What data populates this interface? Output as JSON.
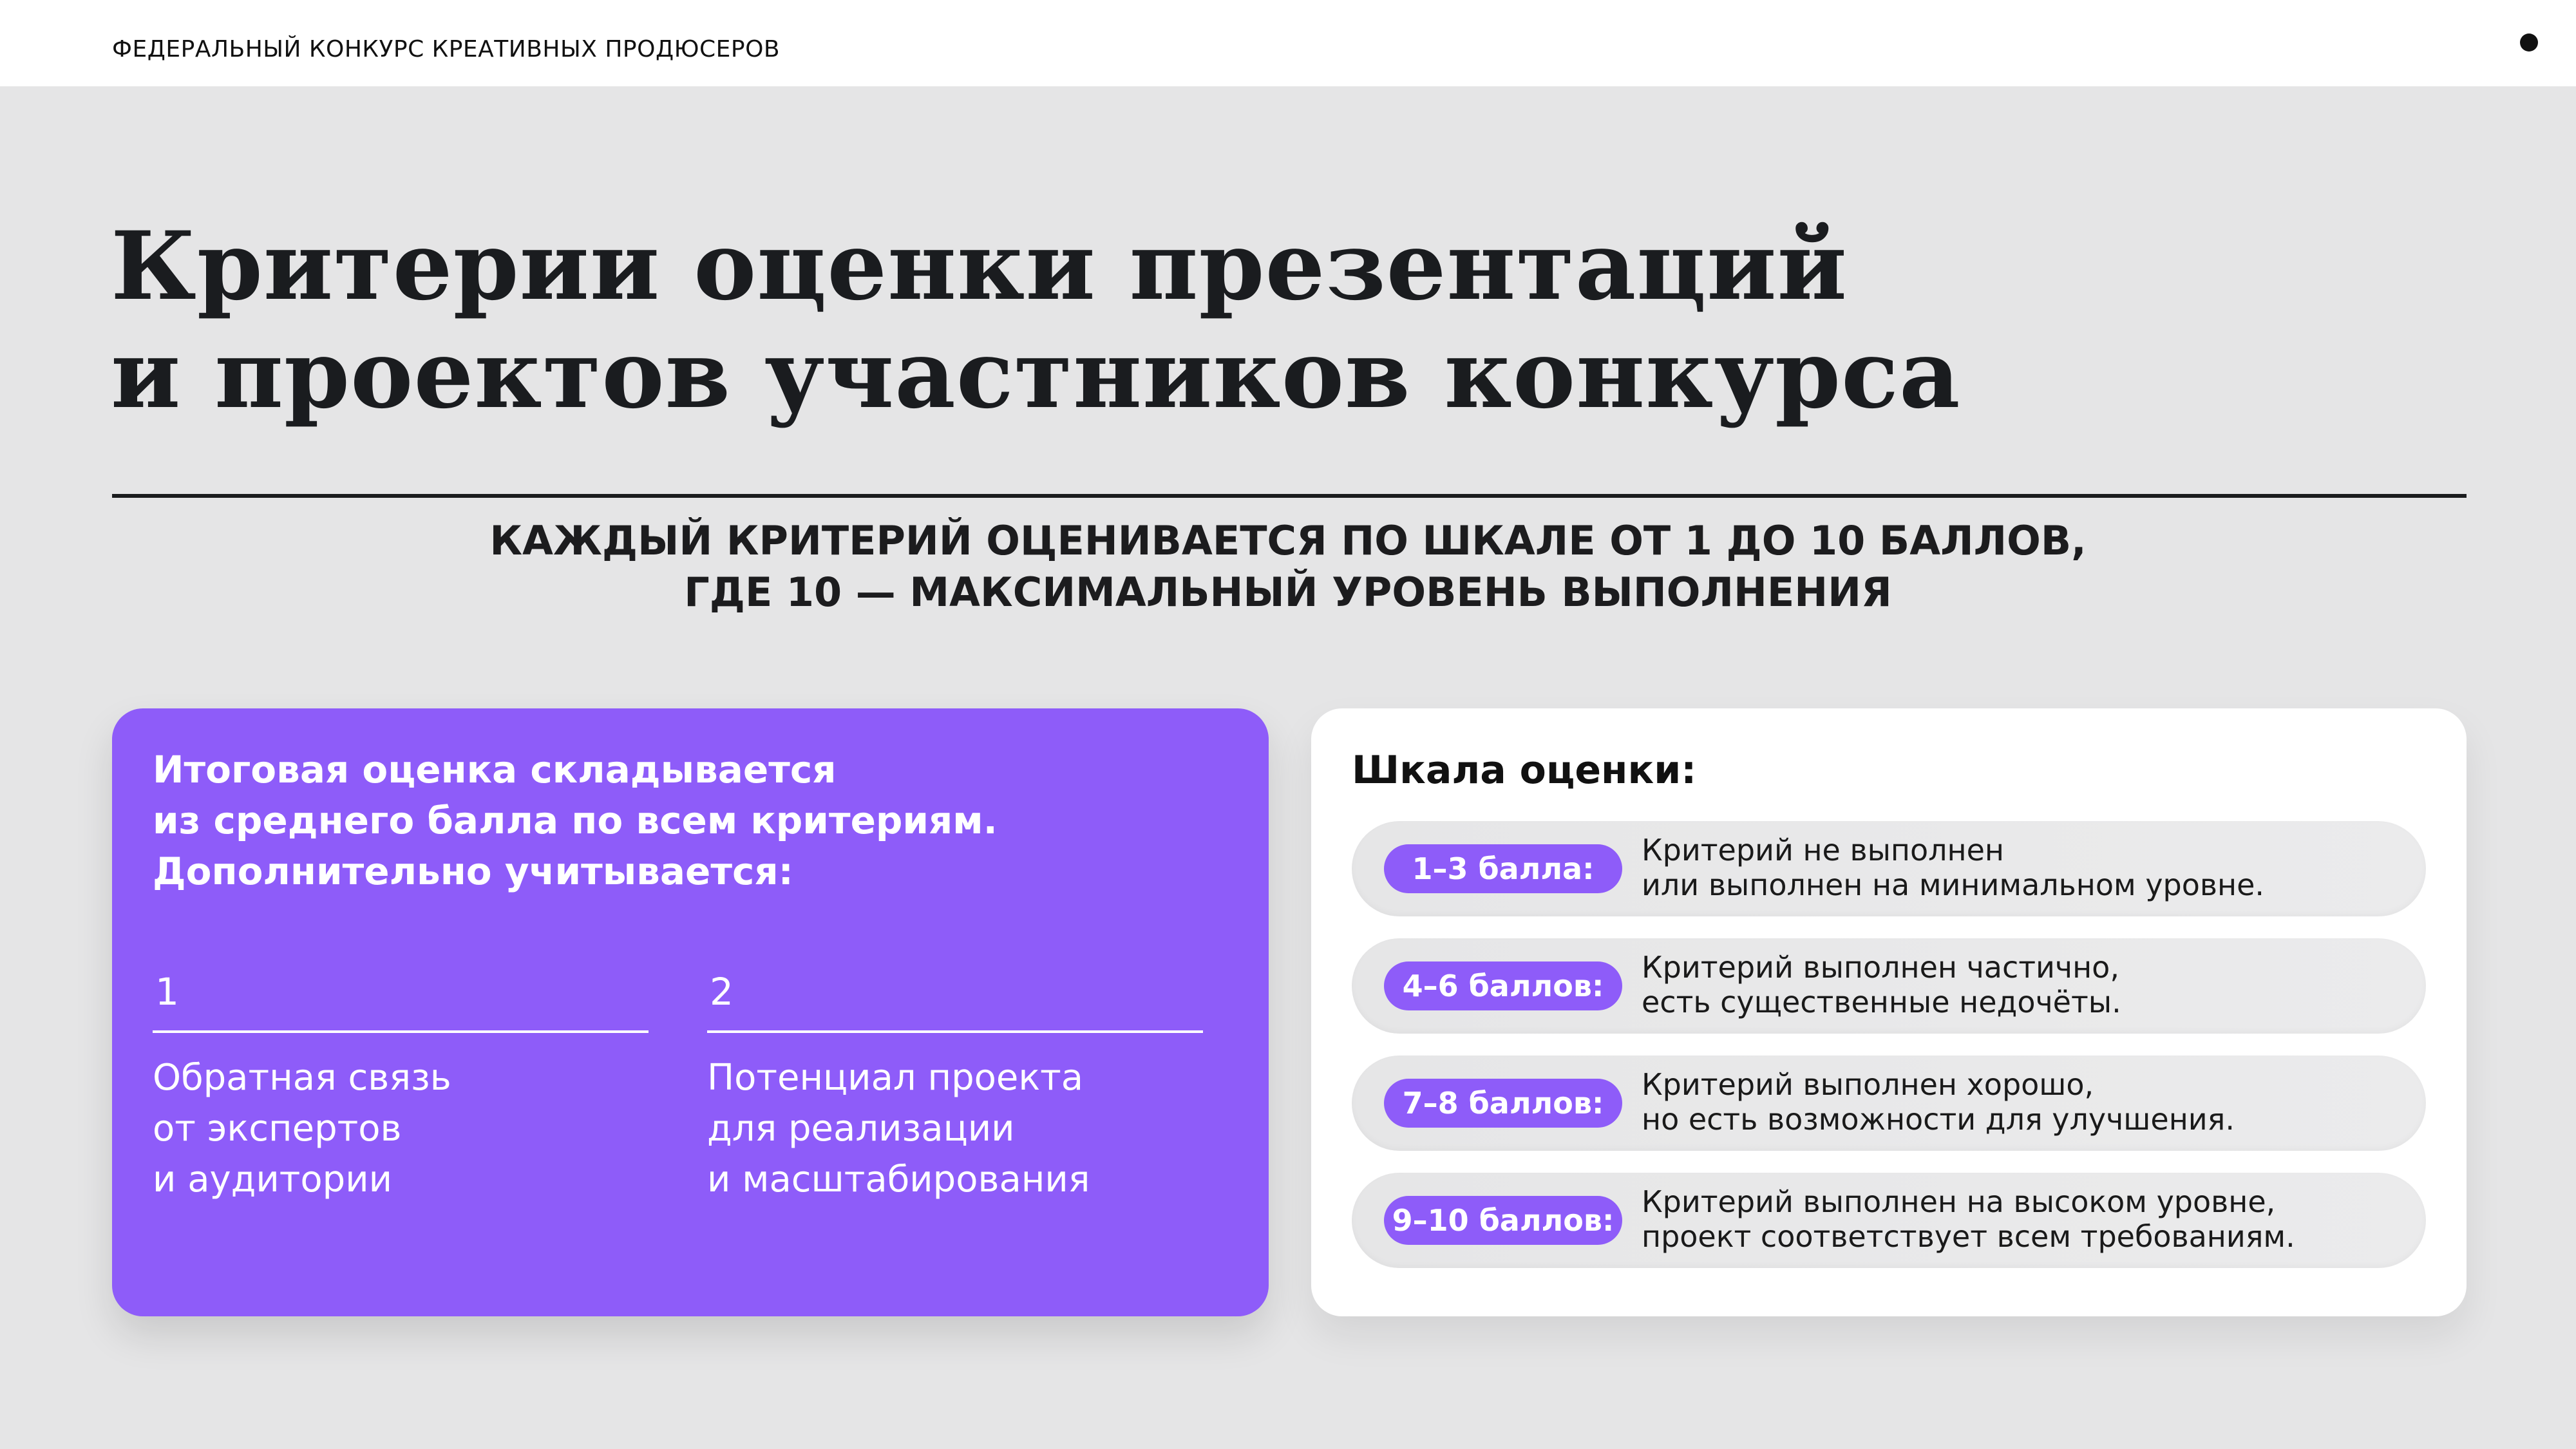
{
  "header": {
    "title": "ФЕДЕРАЛЬНЫЙ КОНКУРС КРЕАТИВНЫХ ПРОДЮСЕРОВ"
  },
  "main": {
    "title_line1": "Критерии оценки презентаций",
    "title_line2": "и проектов участников конкурса",
    "subtitle_line1": "КАЖДЫЙ КРИТЕРИЙ ОЦЕНИВАЕТСЯ ПО ШКАЛЕ ОТ 1 ДО 10 БАЛЛОВ,",
    "subtitle_line2": "ГДЕ 10 — МАКСИМАЛЬНЫЙ УРОВЕНЬ ВЫПОЛНЕНИЯ"
  },
  "summary_card": {
    "intro_line1": "Итоговая оценка складывается",
    "intro_line2": "из среднего балла по всем критериям.",
    "intro_line3": "Дополнительно учитывается:",
    "factors": [
      {
        "number": "1",
        "line1": "Обратная связь",
        "line2": "от экспертов",
        "line3": "и аудитории"
      },
      {
        "number": "2",
        "line1": "Потенциал проекта",
        "line2": "для реализации",
        "line3": "и масштабирования"
      }
    ],
    "accent_color": "#8E5CF9"
  },
  "scale_card": {
    "title": "Шкала оценки:",
    "rows": [
      {
        "badge": "1–3 балла:",
        "line1": "Критерий не выполнен",
        "line2": "или выполнен на минимальном уровне."
      },
      {
        "badge": "4–6 баллов:",
        "line1": "Критерий выполнен частично,",
        "line2": "есть существенные недочёты."
      },
      {
        "badge": "7–8 баллов:",
        "line1": "Критерий выполнен хорошо,",
        "line2": "но есть возможности для улучшения."
      },
      {
        "badge": "9–10 баллов:",
        "line1": "Критерий выполнен на высоком уровне,",
        "line2": "проект соответствует всем требованиям."
      }
    ]
  }
}
